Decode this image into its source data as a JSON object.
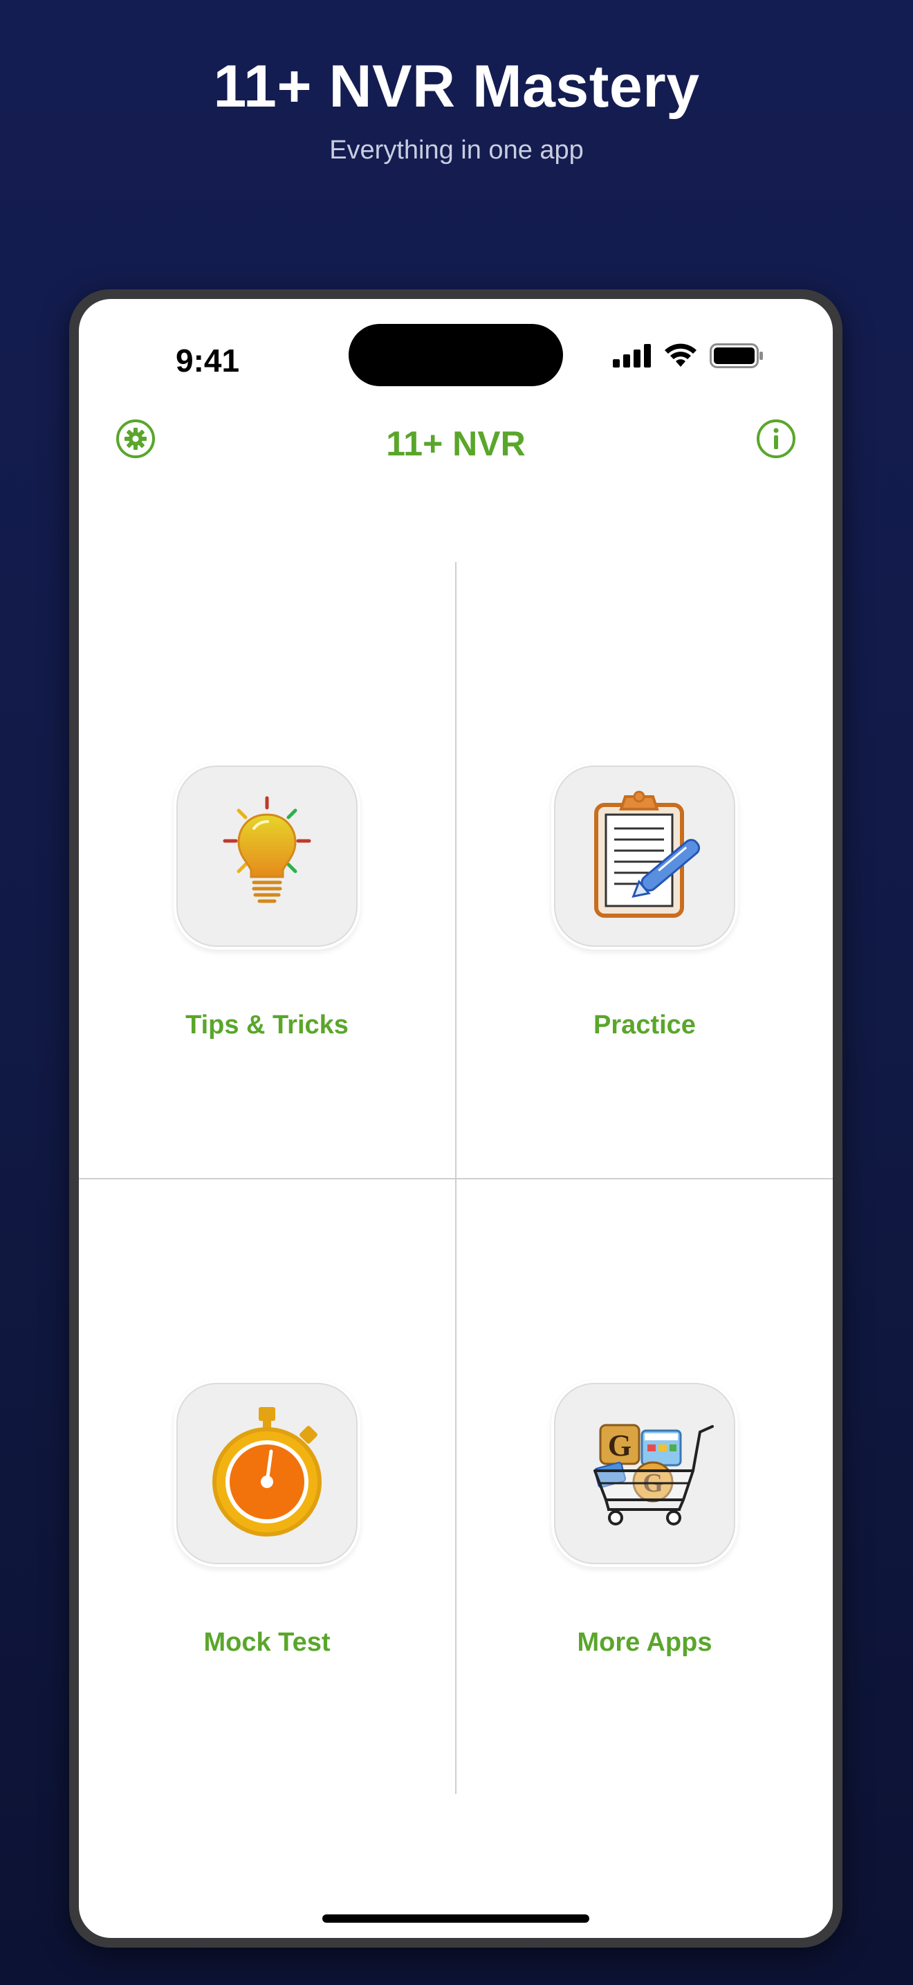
{
  "promo": {
    "title": "11+ NVR Mastery",
    "subtitle": "Everything in one app"
  },
  "status_bar": {
    "time": "9:41"
  },
  "navbar": {
    "title": "11+ NVR",
    "left_icon": "gear-icon",
    "right_icon": "info-icon"
  },
  "menu": {
    "items": [
      {
        "label": "Tips & Tricks",
        "icon": "lightbulb-icon"
      },
      {
        "label": "Practice",
        "icon": "clipboard-pen-icon"
      },
      {
        "label": "Mock Test",
        "icon": "stopwatch-icon"
      },
      {
        "label": "More Apps",
        "icon": "shopping-cart-icon"
      }
    ]
  },
  "colors": {
    "accent": "#5aa62b",
    "background": "#141d52",
    "tile": "#efefef"
  }
}
